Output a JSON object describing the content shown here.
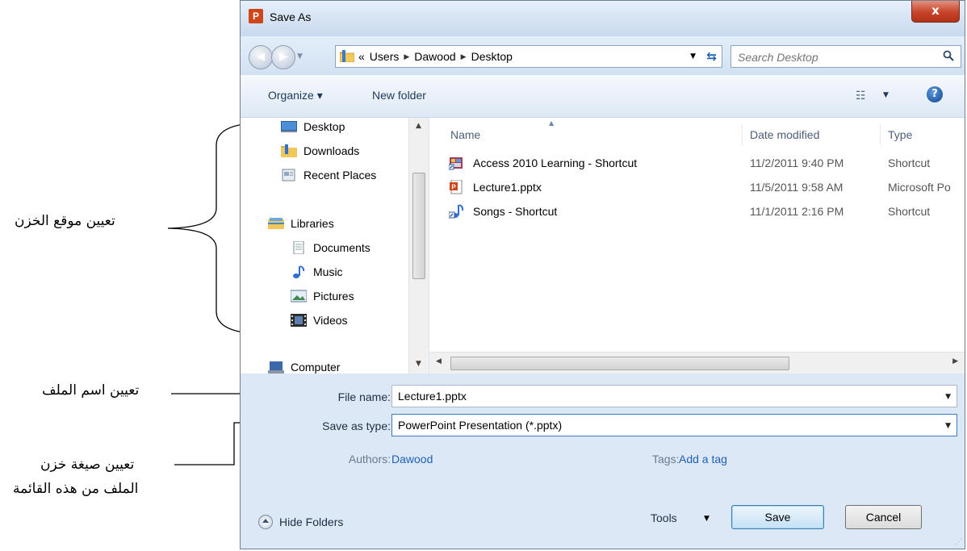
{
  "annotations": {
    "storage_location": "تعيين موقع الخزن",
    "file_name": "تعيين اسم الملف",
    "file_type_line1": "تعيين صيغة خزن",
    "file_type_line2": "الملف من هذه القائمة"
  },
  "dialog": {
    "app_icon": "P",
    "title": "Save As",
    "close_label": "x"
  },
  "navbar": {
    "breadcrumb_prefix": "«",
    "breadcrumb": [
      "Users",
      "Dawood",
      "Desktop"
    ],
    "breadcrumb_separator": "▶",
    "search_placeholder": "Search Desktop"
  },
  "toolbar": {
    "organize_label": "Organize ▾",
    "new_folder_label": "New folder"
  },
  "nav_pane": {
    "favorites": [
      "Desktop",
      "Downloads",
      "Recent Places"
    ],
    "libraries_label": "Libraries",
    "libraries": [
      "Documents",
      "Music",
      "Pictures",
      "Videos"
    ],
    "computer_label": "Computer"
  },
  "file_list": {
    "columns": {
      "name": "Name",
      "date": "Date modified",
      "type": "Type"
    },
    "rows": [
      {
        "name": "Access 2010 Learning - Shortcut",
        "date": "11/2/2011 9:40 PM",
        "type": "Shortcut",
        "icon": "shortcut-icon"
      },
      {
        "name": "Lecture1.pptx",
        "date": "11/5/2011 9:58 AM",
        "type": "Microsoft Po",
        "icon": "pptx-file-icon"
      },
      {
        "name": "Songs - Shortcut",
        "date": "11/1/2011 2:16 PM",
        "type": "Shortcut",
        "icon": "music-shortcut-icon"
      }
    ]
  },
  "form": {
    "file_name_label": "File name:",
    "file_name_value": "Lecture1.pptx",
    "save_type_label": "Save as type:",
    "save_type_value": "PowerPoint Presentation (*.pptx)",
    "authors_label": "Authors:",
    "authors_value": "Dawood",
    "tags_label": "Tags:",
    "tags_value": "Add a tag"
  },
  "footer": {
    "hide_folders_label": "Hide Folders",
    "tools_label": "Tools",
    "save_label": "Save",
    "cancel_label": "Cancel"
  },
  "colors": {
    "dialog_bg": "#dce8f5",
    "link": "#1e5fb8",
    "close_button": "#c7432a"
  }
}
